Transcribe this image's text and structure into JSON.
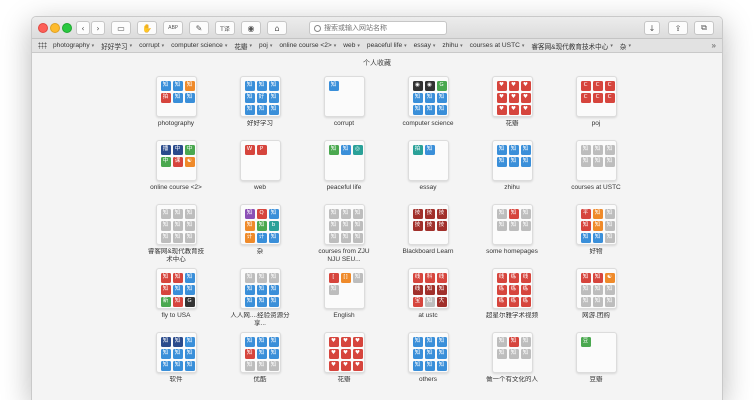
{
  "search": {
    "placeholder": "搜索或输入网站名称"
  },
  "page_title": "个人收藏",
  "toolbar": {
    "back_icon": "‹",
    "forward_icon": "›",
    "buttons": [
      {
        "name": "sidebar-toggle",
        "icon": "▭"
      },
      {
        "name": "ext-hand",
        "icon": "✋"
      },
      {
        "name": "ext-proxy",
        "icon": "ABP"
      },
      {
        "name": "ext-link",
        "icon": "✎"
      },
      {
        "name": "ext-translate",
        "icon": "T译"
      },
      {
        "name": "ext-github",
        "icon": "◉"
      },
      {
        "name": "ext-pocket",
        "icon": "⌂"
      },
      {
        "name": "download",
        "icon": "↓"
      },
      {
        "name": "share",
        "icon": "⇪"
      },
      {
        "name": "tabs",
        "icon": "⧉"
      }
    ]
  },
  "bookmarks_bar": [
    "photography",
    "好好学习",
    "corrupt",
    "computer science",
    "花瓣",
    "poj",
    "online course <2>",
    "web",
    "peaceful life",
    "essay",
    "zhihu",
    "courses at USTC",
    "睿客网&现代教育技术中心",
    "杂"
  ],
  "bookmarks_more": "»",
  "colors": {
    "blue": "#3a8fd9",
    "red": "#d6453d",
    "green": "#4aa84f",
    "orange": "#ef8a2a",
    "purple": "#8b4fb5",
    "dark": "#333333",
    "gray": "#bdbdbd",
    "teal": "#2aa198",
    "brown": "#8a5a2b",
    "darkred": "#a1302b",
    "navy": "#2b4b8c"
  },
  "folders": [
    {
      "label": "photography",
      "icons": [
        [
          "b",
          "知"
        ],
        [
          "b",
          "知"
        ],
        [
          "o",
          "知"
        ],
        [
          "r",
          "拍"
        ],
        [
          "b",
          "知"
        ],
        [
          "b",
          "知"
        ]
      ]
    },
    {
      "label": "好好学习",
      "icons": [
        [
          "b",
          "知"
        ],
        [
          "b",
          "知"
        ],
        [
          "b",
          "知"
        ],
        [
          "b",
          "知"
        ],
        [
          "b",
          "好"
        ],
        [
          "b",
          "知"
        ],
        [
          "b",
          "知"
        ],
        [
          "b",
          "知"
        ],
        [
          "b",
          "知"
        ]
      ]
    },
    {
      "label": "corrupt",
      "icons": [
        [
          "b",
          "知"
        ]
      ]
    },
    {
      "label": "computer science",
      "icons": [
        [
          "d",
          "◉"
        ],
        [
          "k",
          "◉"
        ],
        [
          "g",
          "G"
        ],
        [
          "b",
          "知"
        ],
        [
          "b",
          "知"
        ],
        [
          "b",
          "知"
        ],
        [
          "b",
          "知"
        ],
        [
          "b",
          "知"
        ],
        [
          "b",
          "知"
        ]
      ]
    },
    {
      "label": "花瓣",
      "icons": [
        [
          "r",
          "♥"
        ],
        [
          "r",
          "♥"
        ],
        [
          "r",
          "♥"
        ],
        [
          "r",
          "♥"
        ],
        [
          "r",
          "♥"
        ],
        [
          "r",
          "♥"
        ],
        [
          "r",
          "♥"
        ],
        [
          "r",
          "♥"
        ],
        [
          "r",
          "♥"
        ]
      ]
    },
    {
      "label": "poj",
      "icons": [
        [
          "r",
          "C"
        ],
        [
          "r",
          "C"
        ],
        [
          "r",
          "C"
        ],
        [
          "r",
          "C"
        ],
        [
          "r",
          "C"
        ],
        [
          "r",
          "C"
        ]
      ]
    },
    {
      "label": "online course <2>",
      "icons": [
        [
          "n",
          "播"
        ],
        [
          "n",
          "中"
        ],
        [
          "g",
          "中"
        ],
        [
          "g",
          "中"
        ],
        [
          "r",
          "课"
        ],
        [
          "o",
          "☯"
        ]
      ]
    },
    {
      "label": "web",
      "icons": [
        [
          "r",
          "W"
        ],
        [
          "r",
          "P"
        ]
      ]
    },
    {
      "label": "peaceful life",
      "icons": [
        [
          "g",
          "知"
        ],
        [
          "b",
          "知"
        ],
        [
          "t",
          "◎"
        ]
      ]
    },
    {
      "label": "essay",
      "icons": [
        [
          "t",
          "拍"
        ],
        [
          "b",
          "知"
        ]
      ]
    },
    {
      "label": "zhihu",
      "icons": [
        [
          "b",
          "知"
        ],
        [
          "b",
          "知"
        ],
        [
          "b",
          "知"
        ],
        [
          "b",
          "知"
        ],
        [
          "b",
          "知"
        ],
        [
          "b",
          "知"
        ]
      ]
    },
    {
      "label": "courses at USTC",
      "icons": [
        [
          "x",
          "知"
        ],
        [
          "x",
          "知"
        ],
        [
          "x",
          "知"
        ],
        [
          "x",
          "知"
        ],
        [
          "x",
          "知"
        ],
        [
          "x",
          "知"
        ]
      ]
    },
    {
      "label": "睿客网&现代教育技术中心",
      "icons": [
        [
          "x",
          "知"
        ],
        [
          "x",
          "知"
        ],
        [
          "x",
          "知"
        ],
        [
          "x",
          "知"
        ],
        [
          "x",
          "知"
        ],
        [
          "x",
          "知"
        ],
        [
          "x",
          "知"
        ],
        [
          "x",
          "知"
        ],
        [
          "x",
          "知"
        ]
      ]
    },
    {
      "label": "杂",
      "icons": [
        [
          "p",
          "知"
        ],
        [
          "r",
          "Q"
        ],
        [
          "b",
          "知"
        ],
        [
          "o",
          "知"
        ],
        [
          "g",
          "知"
        ],
        [
          "t",
          "b"
        ],
        [
          "o",
          "计"
        ],
        [
          "b",
          "计"
        ],
        [
          "b",
          "知"
        ]
      ]
    },
    {
      "label": "courses from ZJU NJU SEU...",
      "icons": [
        [
          "x",
          "知"
        ],
        [
          "x",
          "知"
        ],
        [
          "x",
          "知"
        ],
        [
          "x",
          "知"
        ],
        [
          "x",
          "知"
        ],
        [
          "x",
          "知"
        ],
        [
          "x",
          "知"
        ],
        [
          "x",
          "知"
        ],
        [
          "x",
          "知"
        ]
      ]
    },
    {
      "label": "Blackboard Learn",
      "icons": [
        [
          "w",
          "技"
        ],
        [
          "w",
          "技"
        ],
        [
          "w",
          "技"
        ],
        [
          "w",
          "技"
        ],
        [
          "w",
          "技"
        ],
        [
          "w",
          "技"
        ]
      ]
    },
    {
      "label": "some homepages",
      "icons": [
        [
          "x",
          "知"
        ],
        [
          "r",
          "知"
        ],
        [
          "x",
          "知"
        ],
        [
          "x",
          "知"
        ],
        [
          "x",
          "知"
        ],
        [
          "x",
          "知"
        ]
      ]
    },
    {
      "label": "好物",
      "icons": [
        [
          "r",
          "平"
        ],
        [
          "o",
          "知"
        ],
        [
          "x",
          "知"
        ],
        [
          "r",
          "知"
        ],
        [
          "o",
          "知"
        ],
        [
          "x",
          "知"
        ],
        [
          "b",
          "知"
        ],
        [
          "b",
          "知"
        ],
        [
          "x",
          "知"
        ]
      ]
    },
    {
      "label": "fly to USA",
      "icons": [
        [
          "r",
          "知"
        ],
        [
          "r",
          "知"
        ],
        [
          "b",
          "知"
        ],
        [
          "r",
          "知"
        ],
        [
          "b",
          "知"
        ],
        [
          "b",
          "知"
        ],
        [
          "g",
          "新"
        ],
        [
          "r",
          "知"
        ],
        [
          "d",
          "G"
        ]
      ]
    },
    {
      "label": "人人网....经验资源分享...",
      "icons": [
        [
          "x",
          "知"
        ],
        [
          "x",
          "知"
        ],
        [
          "x",
          "知"
        ],
        [
          "b",
          "知"
        ],
        [
          "b",
          "知"
        ],
        [
          "b",
          "知"
        ],
        [
          "b",
          "知"
        ],
        [
          "b",
          "知"
        ],
        [
          "b",
          "知"
        ]
      ]
    },
    {
      "label": "English",
      "icons": [
        [
          "r",
          "["
        ],
        [
          "o",
          "[]"
        ],
        [
          "x",
          "知"
        ],
        [
          "x",
          "知"
        ]
      ]
    },
    {
      "label": "at ustc",
      "icons": [
        [
          "r",
          "线"
        ],
        [
          "r",
          "科"
        ],
        [
          "r",
          "线"
        ],
        [
          "w",
          "线"
        ],
        [
          "w",
          "知"
        ],
        [
          "w",
          "知"
        ],
        [
          "r",
          "宝"
        ],
        [
          "x",
          "知"
        ],
        [
          "w",
          "大"
        ]
      ]
    },
    {
      "label": "超星尔雅学术视频",
      "icons": [
        [
          "r",
          "线"
        ],
        [
          "r",
          "练"
        ],
        [
          "r",
          "线"
        ],
        [
          "r",
          "练"
        ],
        [
          "r",
          "练"
        ],
        [
          "r",
          "练"
        ],
        [
          "r",
          "练"
        ],
        [
          "r",
          "练"
        ],
        [
          "r",
          "练"
        ]
      ]
    },
    {
      "label": "网游.团购",
      "icons": [
        [
          "r",
          "知"
        ],
        [
          "r",
          "知"
        ],
        [
          "o",
          "☯"
        ],
        [
          "x",
          "知"
        ],
        [
          "x",
          "知"
        ],
        [
          "x",
          "知"
        ],
        [
          "x",
          "知"
        ],
        [
          "x",
          "知"
        ],
        [
          "x",
          "知"
        ]
      ]
    },
    {
      "label": "软件",
      "icons": [
        [
          "n",
          "知"
        ],
        [
          "n",
          "知"
        ],
        [
          "b",
          "知"
        ],
        [
          "b",
          "知"
        ],
        [
          "b",
          "知"
        ],
        [
          "b",
          "知"
        ],
        [
          "b",
          "知"
        ],
        [
          "b",
          "知"
        ],
        [
          "b",
          "知"
        ]
      ]
    },
    {
      "label": "优酷",
      "icons": [
        [
          "b",
          "知"
        ],
        [
          "b",
          "知"
        ],
        [
          "b",
          "知"
        ],
        [
          "r",
          "知"
        ],
        [
          "b",
          "知"
        ],
        [
          "b",
          "知"
        ],
        [
          "x",
          "知"
        ],
        [
          "x",
          "知"
        ],
        [
          "x",
          "知"
        ]
      ]
    },
    {
      "label": "花瓣",
      "icons": [
        [
          "r",
          "♥"
        ],
        [
          "r",
          "♥"
        ],
        [
          "r",
          "♥"
        ],
        [
          "r",
          "♥"
        ],
        [
          "r",
          "♥"
        ],
        [
          "r",
          "♥"
        ],
        [
          "r",
          "♥"
        ],
        [
          "r",
          "♥"
        ],
        [
          "r",
          "♥"
        ]
      ]
    },
    {
      "label": "others",
      "icons": [
        [
          "b",
          "知"
        ],
        [
          "b",
          "知"
        ],
        [
          "b",
          "知"
        ],
        [
          "b",
          "知"
        ],
        [
          "b",
          "知"
        ],
        [
          "b",
          "知"
        ],
        [
          "b",
          "知"
        ],
        [
          "b",
          "知"
        ],
        [
          "b",
          "知"
        ]
      ]
    },
    {
      "label": "做一个有文化的人",
      "icons": [
        [
          "x",
          "知"
        ],
        [
          "r",
          "知"
        ],
        [
          "x",
          "知"
        ],
        [
          "x",
          "知"
        ],
        [
          "x",
          "知"
        ],
        [
          "x",
          "知"
        ]
      ]
    },
    {
      "label": "豆瓣",
      "icons": [
        [
          "g",
          "豆"
        ]
      ]
    }
  ]
}
